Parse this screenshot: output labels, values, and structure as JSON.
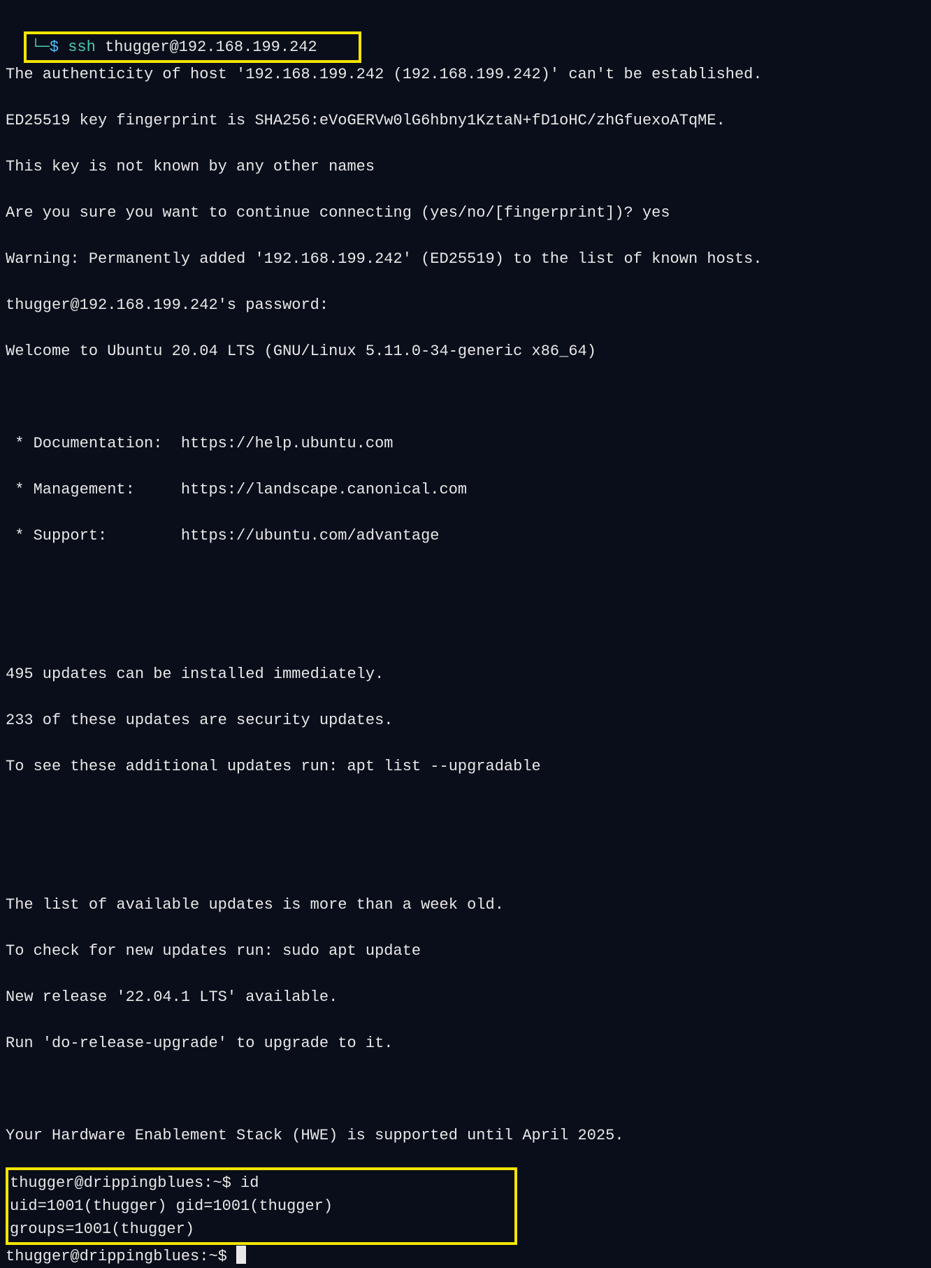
{
  "prompt1": {
    "branch": "└─",
    "dollar": "$",
    "cmd": "ssh",
    "args": "thugger@192.168.199.242"
  },
  "lines": {
    "l1": "The authenticity of host '192.168.199.242 (192.168.199.242)' can't be established.",
    "l2": "ED25519 key fingerprint is SHA256:eVoGERVw0lG6hbny1KztaN+fD1oHC/zhGfuexoATqME.",
    "l3": "This key is not known by any other names",
    "l4": "Are you sure you want to continue connecting (yes/no/[fingerprint])? yes",
    "l5": "Warning: Permanently added '192.168.199.242' (ED25519) to the list of known hosts.",
    "l6": "thugger@192.168.199.242's password:",
    "l7": "Welcome to Ubuntu 20.04 LTS (GNU/Linux 5.11.0-34-generic x86_64)",
    "l8": " * Documentation:  https://help.ubuntu.com",
    "l9": " * Management:     https://landscape.canonical.com",
    "l10": " * Support:        https://ubuntu.com/advantage",
    "l11": "495 updates can be installed immediately.",
    "l12": "233 of these updates are security updates.",
    "l13": "To see these additional updates run: apt list --upgradable",
    "l14": "The list of available updates is more than a week old.",
    "l15": "To check for new updates run: sudo apt update",
    "l16": "New release '22.04.1 LTS' available.",
    "l17": "Run 'do-release-upgrade' to upgrade to it.",
    "l18": "Your Hardware Enablement Stack (HWE) is supported until April 2025."
  },
  "box2": {
    "line1_prompt": "thugger@drippingblues:~$",
    "line1_cmd": " id",
    "line2": "uid=1001(thugger) gid=1001(thugger) groups=1001(thugger)"
  },
  "prompt_final": "thugger@drippingblues:~$ "
}
